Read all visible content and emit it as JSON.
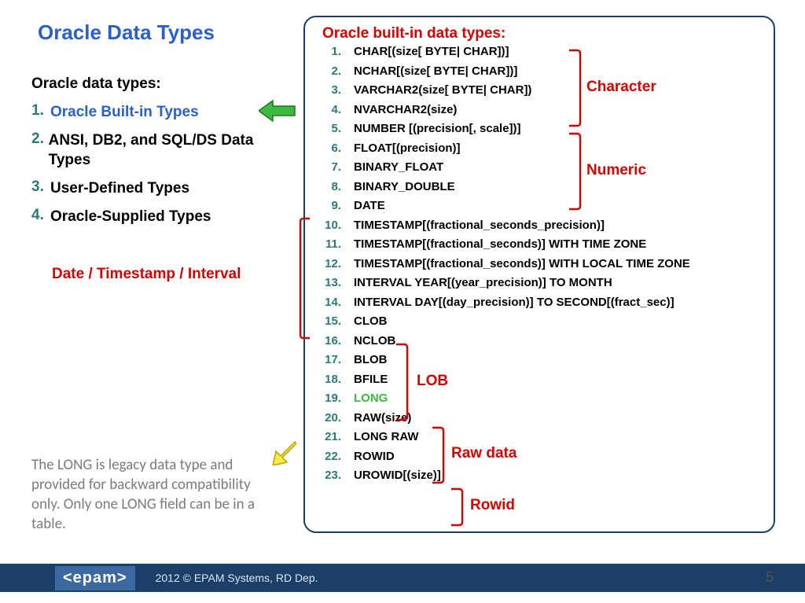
{
  "title": "Oracle Data Types",
  "left": {
    "heading": "Oracle data types:",
    "items": [
      {
        "n": "1.",
        "label": "Oracle Built-in Types",
        "hl": true
      },
      {
        "n": "2.",
        "label": "ANSI, DB2, and SQL/DS Data Types",
        "hl": false
      },
      {
        "n": "3.",
        "label": "User-Defined Types",
        "hl": false
      },
      {
        "n": "4.",
        "label": "Oracle-Supplied Types",
        "hl": false
      }
    ],
    "red_note": "Date / Timestamp / Interval",
    "footnote": "The LONG is legacy data type and provided for backward compatibility only. Only one LONG field can be in a table."
  },
  "panel": {
    "title": "Oracle built-in data types:",
    "types": [
      {
        "n": "1.",
        "label": "CHAR[(size[ BYTE| CHAR])]"
      },
      {
        "n": "2.",
        "label": "NCHAR[(size[ BYTE| CHAR])]"
      },
      {
        "n": "3.",
        "label": "VARCHAR2(size[ BYTE| CHAR])"
      },
      {
        "n": "4.",
        "label": "NVARCHAR2(size)"
      },
      {
        "n": "5.",
        "label": "NUMBER [(precision[, scale])]"
      },
      {
        "n": "6.",
        "label": "FLOAT[(precision)]"
      },
      {
        "n": "7.",
        "label": "BINARY_FLOAT"
      },
      {
        "n": "8.",
        "label": "BINARY_DOUBLE"
      },
      {
        "n": "9.",
        "label": "DATE"
      },
      {
        "n": "10.",
        "label": "TIMESTAMP[(fractional_seconds_precision)]"
      },
      {
        "n": "11.",
        "label": "TIMESTAMP[(fractional_seconds)] WITH TIME ZONE"
      },
      {
        "n": "12.",
        "label": "TIMESTAMP[(fractional_seconds)] WITH LOCAL TIME ZONE"
      },
      {
        "n": "13.",
        "label": "INTERVAL YEAR[(year_precision)] TO MONTH"
      },
      {
        "n": "14.",
        "label": "INTERVAL DAY[(day_precision)] TO SECOND[(fract_sec)]"
      },
      {
        "n": "15.",
        "label": "CLOB"
      },
      {
        "n": "16.",
        "label": "NCLOB"
      },
      {
        "n": "17.",
        "label": "BLOB"
      },
      {
        "n": "18.",
        "label": "BFILE"
      },
      {
        "n": "19.",
        "label": "LONG",
        "long": true
      },
      {
        "n": "20.",
        "label": "RAW(size)"
      },
      {
        "n": "21.",
        "label": "LONG RAW"
      },
      {
        "n": "22.",
        "label": "ROWID"
      },
      {
        "n": "23.",
        "label": "UROWID[(size)]"
      }
    ],
    "groups": {
      "character": "Character",
      "numeric": "Numeric",
      "lob": "LOB",
      "raw": "Raw data",
      "rowid": "Rowid"
    }
  },
  "footer": {
    "brand": "<epam>",
    "copyright": "2012 © EPAM Systems, RD Dep.",
    "page": "5"
  }
}
